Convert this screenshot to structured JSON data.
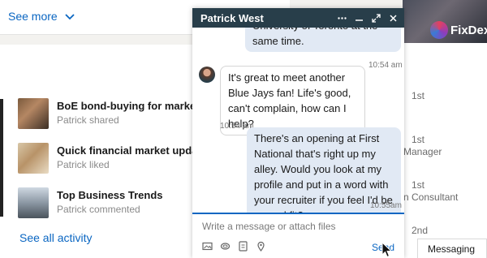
{
  "feed": {
    "see_more_label": "See more",
    "activities": [
      {
        "title": "BoE bond-buying for markets",
        "subtitle": "Patrick shared"
      },
      {
        "title": "Quick financial market update",
        "subtitle": "Patrick liked"
      },
      {
        "title": "Top Business Trends",
        "subtitle": "Patrick commented"
      }
    ],
    "see_all_label": "See all activity"
  },
  "sidebar": {
    "brand": "FixDex",
    "fragments": [
      "1st",
      "1st",
      "Manager",
      "1st",
      "n Consultant",
      "2nd"
    ]
  },
  "chat": {
    "name": "Patrick West",
    "messages": [
      {
        "text": "University of Toronto at the same time.",
        "time": "10:54 am",
        "direction": "out"
      },
      {
        "text": "It's great to meet another Blue Jays fan! Life's good, can't complain, how can I help?",
        "time": "10:54 am",
        "direction": "in"
      },
      {
        "text": "There's an opening at First National that's right up my alley. Would you look at my profile and put in a word with your recruiter if you feel I'd be a good fit?",
        "time": "10:55am",
        "direction": "out"
      }
    ],
    "composer_placeholder": "Write a message or attach files",
    "send_label": "Send"
  },
  "messaging_tab_label": "Messaging",
  "colors": {
    "header": "#283e4a",
    "accent": "#0a66c2",
    "outgoing_bubble": "#e1e9f4"
  }
}
